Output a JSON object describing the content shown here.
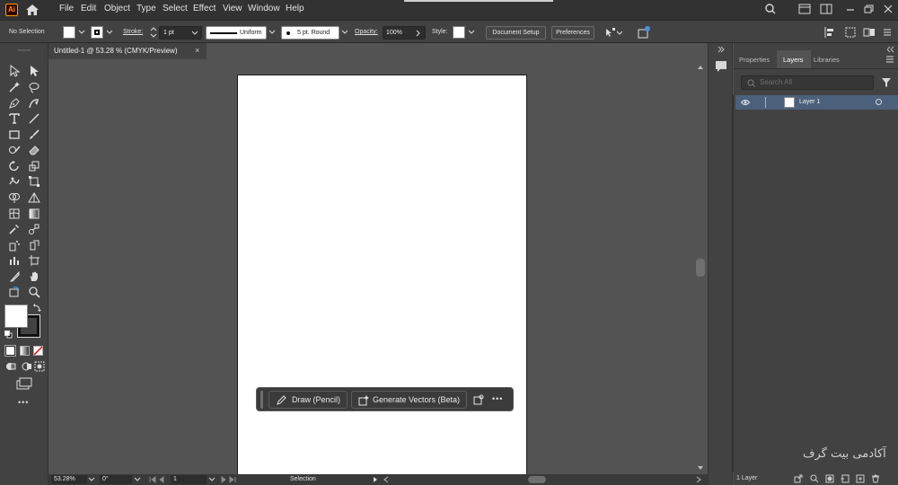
{
  "app": {
    "logo_text": "Ai"
  },
  "menu": [
    "File",
    "Edit",
    "Object",
    "Type",
    "Select",
    "Effect",
    "View",
    "Window",
    "Help"
  ],
  "control_bar": {
    "selection_status": "No Selection",
    "stroke_label": "Stroke:",
    "stroke_value": "1 pt",
    "stroke_profile": "Uniform",
    "brush": "5 pt. Round",
    "opacity_label": "Opacity:",
    "opacity_value": "100%",
    "style_label": "Style:",
    "document_setup": "Document Setup",
    "preferences": "Preferences"
  },
  "document_tab": {
    "title": "Untitled-1 @ 53.28 % (CMYK/Preview)",
    "close": "×"
  },
  "taskbar": {
    "draw_label": "Draw (Pencil)",
    "generate_label": "Generate Vectors (Beta)",
    "more": "•••"
  },
  "toolbar": {
    "more": "•••"
  },
  "status_bar": {
    "zoom": "53.28%",
    "rotation": "0°",
    "artboard_number": "1",
    "tool_status": "Selection"
  },
  "panel": {
    "tabs": [
      "Properties",
      "Layers",
      "Libraries"
    ],
    "active_tab": "Layers",
    "search_placeholder": "Search All",
    "layers": [
      {
        "name": "Layer 1"
      }
    ],
    "layer_count": "1 Layer"
  },
  "watermark": "آکادمی بیت گرف",
  "colors": {
    "accent": "#ff9a00",
    "selection_row": "#4b607b",
    "canvas": "#535353",
    "panel": "#424242"
  }
}
